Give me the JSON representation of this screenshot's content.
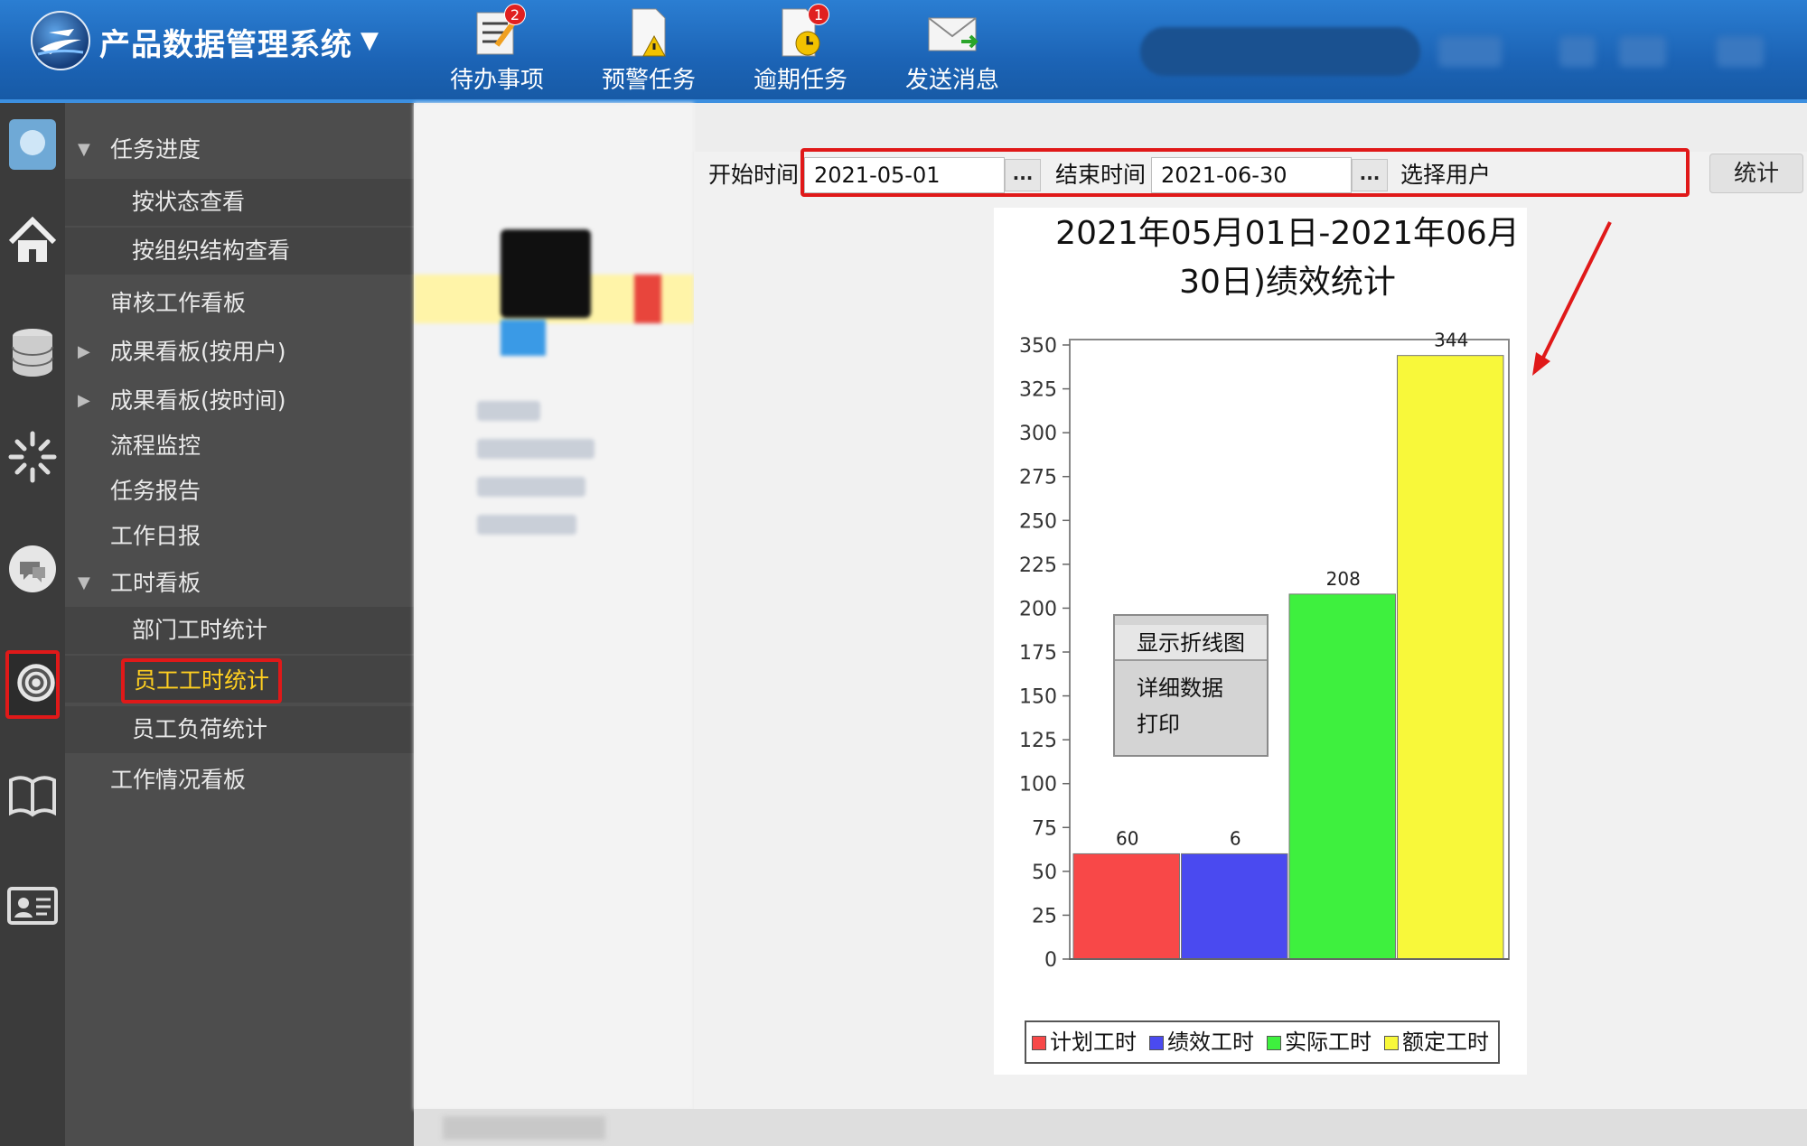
{
  "app": {
    "title": "产品数据管理系统"
  },
  "toolbar": {
    "items": [
      {
        "label": "待办事项",
        "icon": "todo-icon",
        "badge": "2"
      },
      {
        "label": "预警任务",
        "icon": "warning-doc-icon"
      },
      {
        "label": "逾期任务",
        "icon": "overdue-icon",
        "badge": "1"
      },
      {
        "label": "发送消息",
        "icon": "mail-icon"
      }
    ]
  },
  "iconbar": {
    "items": [
      "avatar-icon",
      "home-icon",
      "database-icon",
      "loading-icon",
      "chat-icon",
      "target-icon",
      "book-icon",
      "id-card-icon"
    ],
    "active": "target-icon"
  },
  "nav": {
    "items": [
      {
        "label": "任务进度",
        "level": 1,
        "arrow": "▼"
      },
      {
        "label": "按状态查看",
        "level": 2
      },
      {
        "label": "按组织结构查看",
        "level": 2
      },
      {
        "label": "审核工作看板",
        "level": 1
      },
      {
        "label": "成果看板(按用户)",
        "level": 1,
        "arrow": "▶"
      },
      {
        "label": "成果看板(按时间)",
        "level": 1,
        "arrow": "▶"
      },
      {
        "label": "流程监控",
        "level": 1
      },
      {
        "label": "任务报告",
        "level": 1
      },
      {
        "label": "工作日报",
        "level": 1
      },
      {
        "label": "工时看板",
        "level": 1,
        "arrow": "▼"
      },
      {
        "label": "部门工时统计",
        "level": 2
      },
      {
        "label": "员工工时统计",
        "level": 2,
        "selected": true
      },
      {
        "label": "员工负荷统计",
        "level": 2
      },
      {
        "label": "工作情况看板",
        "level": 1
      }
    ]
  },
  "filter": {
    "start_label": "开始时间",
    "start_value": "2021-05-01",
    "end_label": "结束时间",
    "end_value": "2021-06-30",
    "picker_label": "...",
    "user_label": "选择用户",
    "stat_button": "统计"
  },
  "context_menu": {
    "items": [
      "显示折线图",
      "详细数据",
      "打印"
    ]
  },
  "colors": {
    "header": "#1c64b6",
    "highlight": "#e01919",
    "selected_text": "#ffcf20"
  },
  "chart_data": {
    "type": "bar",
    "title": "2021年05月01日-2021年06月30日)绩效统计",
    "categories": [
      "计划工时",
      "绩效工时",
      "实际工时",
      "额定工时"
    ],
    "values": [
      60,
      60,
      208,
      344
    ],
    "value_labels": [
      "60",
      "6",
      "208",
      "344"
    ],
    "colors": [
      "#f84848",
      "#4a4af0",
      "#3ef03e",
      "#f8f83a"
    ],
    "ylim": [
      0,
      350
    ],
    "yticks": [
      0,
      25,
      50,
      75,
      100,
      125,
      150,
      175,
      200,
      225,
      250,
      275,
      300,
      325,
      350
    ],
    "legend": [
      "计划工时",
      "绩效工时",
      "实际工时",
      "额定工时"
    ],
    "legend_position": "bottom",
    "grid": false
  }
}
